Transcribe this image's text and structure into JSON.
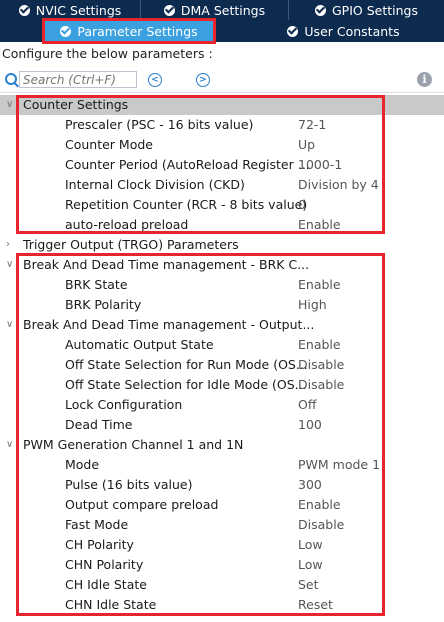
{
  "tabs_top": [
    {
      "label": "NVIC Settings"
    },
    {
      "label": "DMA Settings"
    },
    {
      "label": "GPIO Settings"
    }
  ],
  "tabs_bottom": [
    {
      "label": "Parameter Settings",
      "active": true
    },
    {
      "label": "User Constants",
      "active": false
    }
  ],
  "configure_label": "Configure the below parameters :",
  "search": {
    "placeholder": "Search (Ctrl+F)"
  },
  "groups": [
    {
      "label": "Counter Settings",
      "expanded": true,
      "selected": true,
      "params": [
        {
          "name": "Prescaler (PSC - 16 bits value)",
          "value": "72-1"
        },
        {
          "name": "Counter Mode",
          "value": "Up"
        },
        {
          "name": "Counter Period (AutoReload Register ...",
          "value": "1000-1"
        },
        {
          "name": "Internal Clock Division (CKD)",
          "value": "Division by 4"
        },
        {
          "name": "Repetition Counter (RCR - 8 bits value)",
          "value": "0"
        },
        {
          "name": "auto-reload preload",
          "value": "Enable"
        }
      ]
    },
    {
      "label": "Trigger Output (TRGO) Parameters",
      "expanded": false,
      "params": []
    },
    {
      "label": "Break And Dead Time management - BRK C...",
      "expanded": true,
      "params": [
        {
          "name": "BRK State",
          "value": "Enable"
        },
        {
          "name": "BRK Polarity",
          "value": "High"
        }
      ]
    },
    {
      "label": "Break And Dead Time management - Output...",
      "expanded": true,
      "params": [
        {
          "name": "Automatic Output State",
          "value": "Enable"
        },
        {
          "name": "Off State Selection for Run Mode (OS...",
          "value": "Disable"
        },
        {
          "name": "Off State Selection for Idle Mode (OS...",
          "value": "Disable"
        },
        {
          "name": "Lock Configuration",
          "value": "Off"
        },
        {
          "name": "Dead Time",
          "value": "100"
        }
      ]
    },
    {
      "label": "PWM Generation Channel 1 and 1N",
      "expanded": true,
      "params": [
        {
          "name": "Mode",
          "value": "PWM mode 1"
        },
        {
          "name": "Pulse (16 bits value)",
          "value": "300"
        },
        {
          "name": "Output compare preload",
          "value": "Enable"
        },
        {
          "name": "Fast Mode",
          "value": "Disable"
        },
        {
          "name": "CH Polarity",
          "value": "Low"
        },
        {
          "name": "CHN Polarity",
          "value": "Low"
        },
        {
          "name": "CH Idle State",
          "value": "Set"
        },
        {
          "name": "CHN Idle State",
          "value": "Reset"
        }
      ]
    }
  ],
  "colors": {
    "tab_bar": "#0d2a4f",
    "tab_active": "#3aa0e0",
    "highlight_box": "#e8242c",
    "selected_row": "#c9c9c9"
  }
}
